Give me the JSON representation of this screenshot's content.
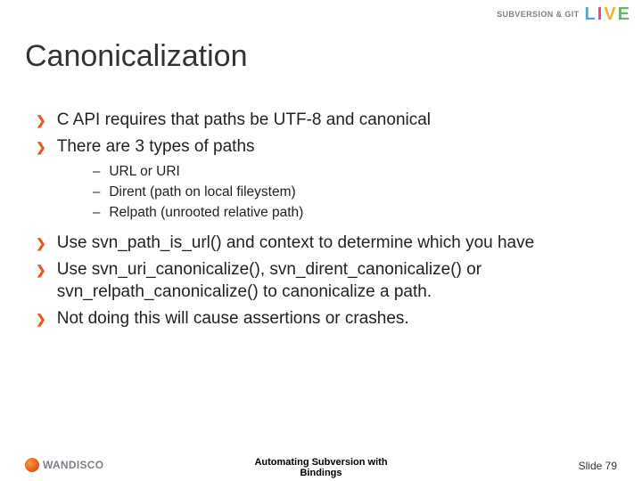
{
  "brand": {
    "top_text": "SUBVERSION & GIT",
    "live": {
      "l": "L",
      "i": "I",
      "v": "V",
      "e": "E"
    }
  },
  "title": "Canonicalization",
  "bullets": {
    "b1": "C API requires that paths be UTF-8 and canonical",
    "b2": "There are 3 types of paths",
    "sub": {
      "s1": "URL or URI",
      "s2": "Dirent (path on local fileystem)",
      "s3": "Relpath (unrooted relative path)"
    },
    "b3": "Use svn_path_is_url() and context to determine which you have",
    "b4": "Use svn_uri_canonicalize(), svn_dirent_canonicalize() or svn_relpath_canonicalize() to canonicalize a path.",
    "b5": "Not doing this will cause assertions or crashes."
  },
  "footer": {
    "wandisco": "WANDISCO",
    "center_line1": "Automating Subversion with",
    "center_line2": "Bindings",
    "slide": "Slide 79"
  }
}
